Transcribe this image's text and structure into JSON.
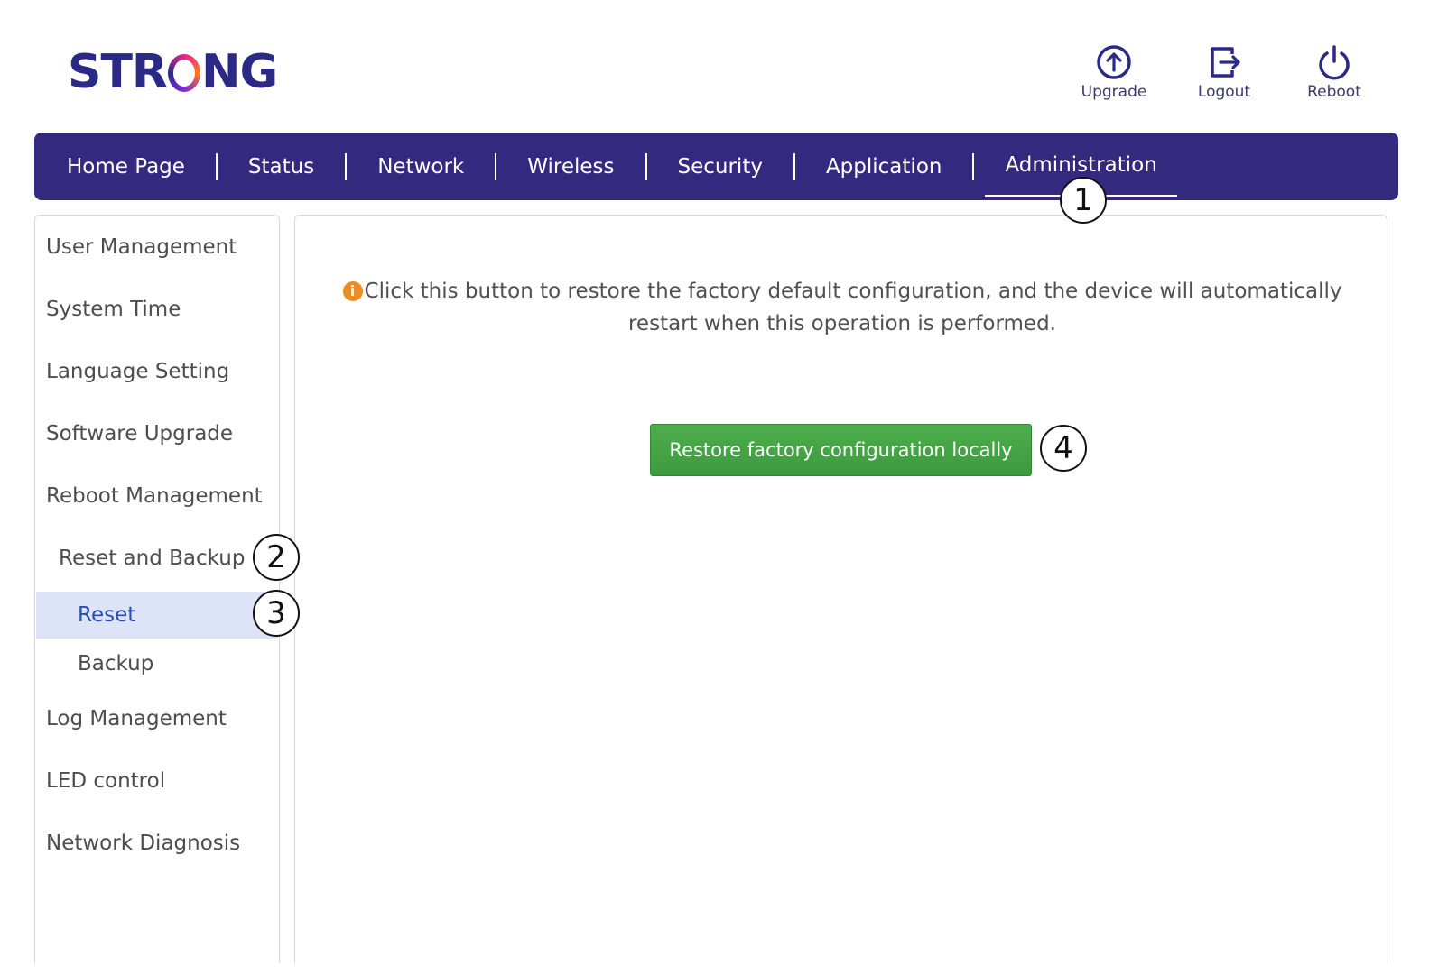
{
  "brand": {
    "logo_left": "STR",
    "logo_right": "NG"
  },
  "header": {
    "actions": [
      {
        "label": "Upgrade",
        "icon": "upload-circle-icon"
      },
      {
        "label": "Logout",
        "icon": "logout-icon"
      },
      {
        "label": "Reboot",
        "icon": "power-icon"
      }
    ]
  },
  "nav": {
    "items": [
      "Home Page",
      "Status",
      "Network",
      "Wireless",
      "Security",
      "Application",
      "Administration"
    ],
    "active": "Administration"
  },
  "sidebar": {
    "items": [
      "User Management",
      "System Time",
      "Language Setting",
      "Software Upgrade",
      "Reboot Management",
      "Reset and Backup",
      "Reset",
      "Backup",
      "Log Management",
      "LED control",
      "Network Diagnosis"
    ],
    "active": "Reset"
  },
  "main": {
    "info_icon": "i",
    "info_text": "Click this button to restore the factory default configuration, and the device will automatically restart when this operation is performed.",
    "restore_button": "Restore factory configuration locally"
  },
  "callouts": [
    "1",
    "2",
    "3",
    "4"
  ],
  "colors": {
    "nav_bg": "#33297f",
    "brand": "#2a2a86",
    "button_green": "#4cae4c",
    "active_bg": "#dde4f8",
    "info_icon": "#f08a24"
  }
}
